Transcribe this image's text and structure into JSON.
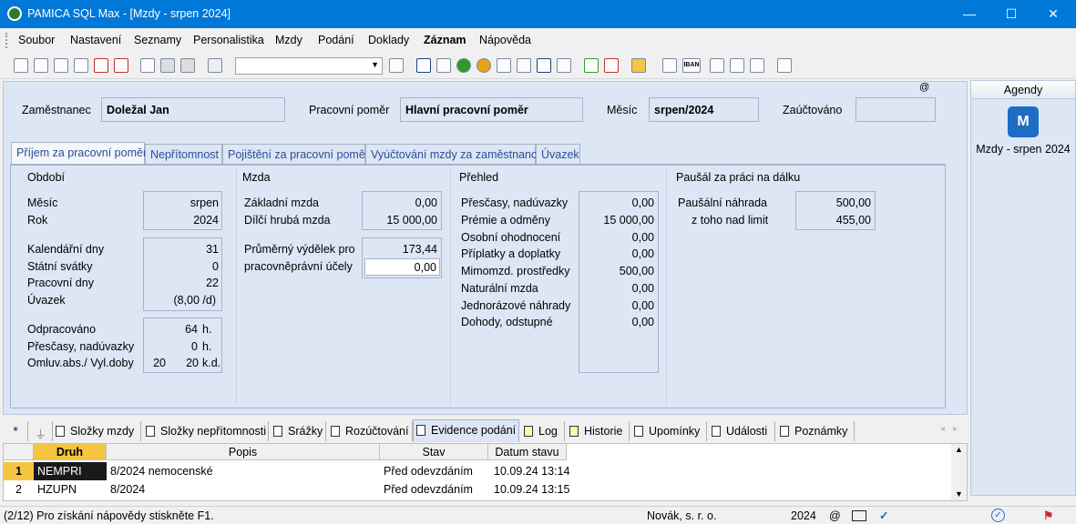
{
  "window": {
    "title": "PAMICA SQL Max - [Mzdy - srpen 2024]",
    "minimize": "—",
    "maximize": "☐",
    "close": "✕"
  },
  "menu": [
    "Soubor",
    "Nastavení",
    "Seznamy",
    "Personalistika",
    "Mzdy",
    "Podání",
    "Doklady",
    "Záznam",
    "Nápověda"
  ],
  "header": {
    "employee_label": "Zaměstnanec",
    "employee_value": "Doležal Jan",
    "contract_label": "Pracovní poměr",
    "contract_value": "Hlavní pracovní poměr",
    "month_label": "Měsíc",
    "month_value": "srpen/2024",
    "posted_label": "Zaúčtováno",
    "posted_value": "",
    "at_symbol": "@"
  },
  "tabs": [
    "Příjem za pracovní poměr",
    "Nepřítomnost",
    "Pojištění za pracovní poměr",
    "Vyúčtování mzdy za zaměstnance",
    "Úvazek"
  ],
  "period": {
    "title": "Období",
    "month_label": "Měsíc",
    "month_value": "srpen",
    "year_label": "Rok",
    "year_value": "2024",
    "calendar_days_label": "Kalendářní dny",
    "calendar_days": "31",
    "holidays_label": "Státní svátky",
    "holidays": "0",
    "workdays_label": "Pracovní dny",
    "workdays": "22",
    "workload_label": "Úvazek",
    "workload": "(8,00 /d)",
    "worked_label": "Odpracováno",
    "worked": "64",
    "worked_unit": "h.",
    "overtime_label": "Přesčasy, nadúvazky",
    "overtime": "0",
    "overtime_unit": "h.",
    "absence_label": "Omluv.abs./ Vyl.doby",
    "absence_a": "20",
    "absence_b": "20",
    "absence_unit": "k.d."
  },
  "wage": {
    "title": "Mzda",
    "base_label": "Základní mzda",
    "base": "0,00",
    "partial_label": "Dílčí hrubá mzda",
    "partial": "15 000,00",
    "avg_label_1": "Průměrný výdělek pro",
    "avg_label_2": "pracovněprávní účely",
    "avg_value": "173,44",
    "avg_input": "0,00"
  },
  "overview": {
    "title": "Přehled",
    "items": [
      {
        "label": "Přesčasy, nadúvazky",
        "value": "0,00"
      },
      {
        "label": "Prémie a odměny",
        "value": "15 000,00"
      },
      {
        "label": "Osobní ohodnocení",
        "value": "0,00"
      },
      {
        "label": "Příplatky a doplatky",
        "value": "0,00"
      },
      {
        "label": "Mimomzd. prostředky",
        "value": "500,00"
      },
      {
        "label": "Naturální mzda",
        "value": "0,00"
      },
      {
        "label": "Jednorázové náhrady",
        "value": "0,00"
      },
      {
        "label": "Dohody, odstupné",
        "value": "0,00"
      }
    ]
  },
  "remote": {
    "title": "Paušál za práci na dálku",
    "allowance_label": "Paušální náhrada",
    "allowance": "500,00",
    "over_limit_label": "z toho nad limit",
    "over_limit": "455,00"
  },
  "agenda": {
    "title": "Agendy",
    "icon": "M",
    "item": "Mzdy - srpen 2024"
  },
  "bottom_tabs": [
    "*",
    "Složky mzdy",
    "Složky nepřítomnosti",
    "Srážky",
    "Rozúčtování",
    "Evidence podání",
    "Log",
    "Historie",
    "Upomínky",
    "Události",
    "Poznámky"
  ],
  "grid": {
    "columns": [
      "Druh",
      "Popis",
      "Stav",
      "Datum stavu"
    ],
    "rows": [
      {
        "num": "1",
        "druh": "NEMPRI",
        "popis": "8/2024  nemocenské",
        "stav": "Před odevzdáním",
        "datum": "10.09.24 13:14"
      },
      {
        "num": "2",
        "druh": "HZUPN",
        "popis": "8/2024",
        "stav": "Před odevzdáním",
        "datum": "10.09.24 13:15"
      }
    ]
  },
  "status": {
    "help": "(2/12) Pro získání nápovědy stiskněte F1.",
    "company": "Novák, s. r. o.",
    "year": "2024",
    "at": "@"
  }
}
